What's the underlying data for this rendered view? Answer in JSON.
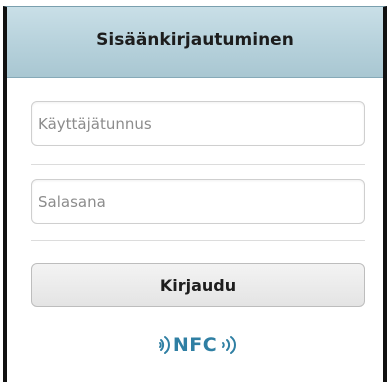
{
  "header": {
    "title": "Sisäänkirjautuminen"
  },
  "form": {
    "username_placeholder": "Käyttäjätunnus",
    "password_placeholder": "Salasana",
    "login_label": "Kirjaudu"
  },
  "nfc": {
    "label": "NFC",
    "color": "#2f7fa3",
    "icon": "nfc-waves-icon"
  },
  "colors": {
    "header_bg": "#b6d1db",
    "button_bg": "#e9e9e9"
  }
}
